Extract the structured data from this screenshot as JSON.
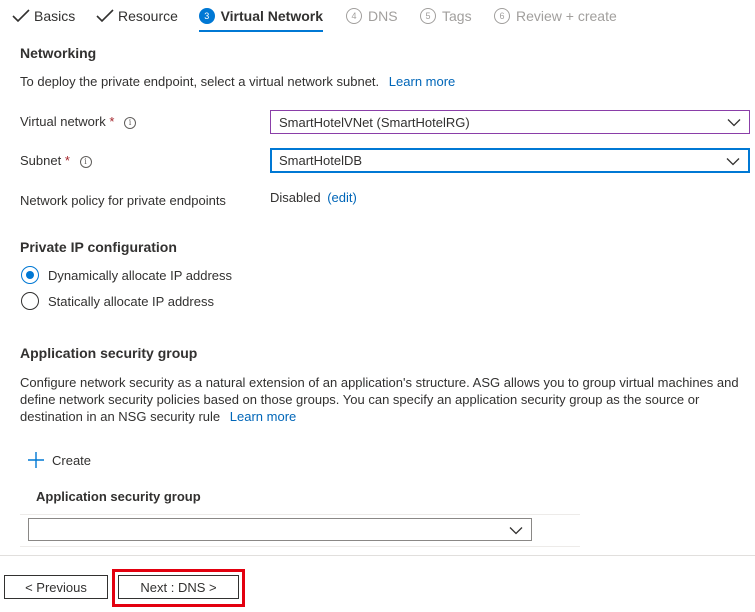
{
  "tabs": [
    {
      "label": "Basics",
      "state": "done"
    },
    {
      "label": "Resource",
      "state": "done"
    },
    {
      "number": "3",
      "label": "Virtual Network",
      "state": "active"
    },
    {
      "number": "4",
      "label": "DNS",
      "state": "disabled"
    },
    {
      "number": "5",
      "label": "Tags",
      "state": "disabled"
    },
    {
      "number": "6",
      "label": "Review + create",
      "state": "disabled"
    }
  ],
  "networking": {
    "heading": "Networking",
    "description": "To deploy the private endpoint, select a virtual network subnet.",
    "learn_more": "Learn more",
    "virtual_network": {
      "label": "Virtual network",
      "required": "*",
      "value": "SmartHotelVNet (SmartHotelRG)"
    },
    "subnet": {
      "label": "Subnet",
      "required": "*",
      "value": "SmartHotelDB"
    },
    "network_policy": {
      "label": "Network policy for private endpoints",
      "value": "Disabled",
      "edit": "(edit)"
    }
  },
  "private_ip": {
    "heading": "Private IP configuration",
    "options": [
      {
        "label": "Dynamically allocate IP address",
        "checked": true
      },
      {
        "label": "Statically allocate IP address",
        "checked": false
      }
    ]
  },
  "asg": {
    "heading": "Application security group",
    "description_line1": "Configure network security as a natural extension of an application's structure. ASG allows you to group virtual machines and",
    "description_line2": "define network security policies based on those groups. You can specify an application security group as the source or",
    "description_line3": "destination in an NSG security rule",
    "learn_more": "Learn more",
    "create_label": "Create",
    "column_header": "Application security group",
    "dropdown_value": ""
  },
  "footer": {
    "previous": "< Previous",
    "next": "Next : DNS >"
  },
  "colors": {
    "accent": "#0078d4",
    "link": "#0066b8",
    "highlight": "#e3000f",
    "required": "#a4262c"
  }
}
